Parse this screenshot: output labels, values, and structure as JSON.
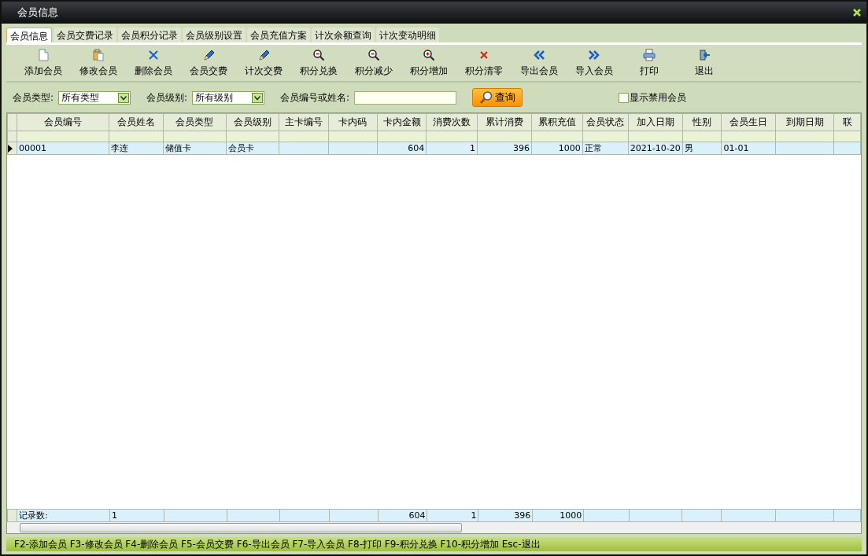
{
  "window": {
    "title": "会员信息"
  },
  "tabs": [
    {
      "label": "会员信息",
      "selected": true
    },
    {
      "label": "会员交费记录",
      "selected": false
    },
    {
      "label": "会员积分记录",
      "selected": false
    },
    {
      "label": "会员级别设置",
      "selected": false
    },
    {
      "label": "会员充值方案",
      "selected": false
    },
    {
      "label": "计次余额查询",
      "selected": false
    },
    {
      "label": "计次变动明细",
      "selected": false
    }
  ],
  "toolbar": [
    "添加会员",
    "修改会员",
    "删除会员",
    "会员交费",
    "计次交费",
    "积分兑换",
    "积分减少",
    "积分增加",
    "积分清零",
    "导出会员",
    "导入会员",
    "打印",
    "退出"
  ],
  "filters": {
    "type_label": "会员类型:",
    "type_value": "所有类型",
    "level_label": "会员级别:",
    "level_value": "所有级别",
    "search_label": "会员编号或姓名:",
    "search_button": "查询",
    "show_disabled": {
      "label": "显示禁用会员",
      "checked": false
    }
  },
  "table": {
    "columns": [
      {
        "label": "会员编号",
        "kind": "text"
      },
      {
        "label": "会员姓名",
        "kind": "text",
        "total": "1"
      },
      {
        "label": "会员类型",
        "kind": "text"
      },
      {
        "label": "会员级别",
        "kind": "text"
      },
      {
        "label": "主卡编号",
        "kind": "text"
      },
      {
        "label": "卡内码",
        "kind": "text"
      },
      {
        "label": "卡内金额",
        "kind": "number",
        "total": "604"
      },
      {
        "label": "消费次数",
        "kind": "number",
        "total": "1"
      },
      {
        "label": "累计消费",
        "kind": "number",
        "total": "396"
      },
      {
        "label": "累积充值",
        "kind": "number",
        "total": "1000"
      },
      {
        "label": "会员状态",
        "kind": "text"
      },
      {
        "label": "加入日期",
        "kind": "text"
      },
      {
        "label": "性别",
        "kind": "text"
      },
      {
        "label": "会员生日",
        "kind": "text"
      },
      {
        "label": "到期日期",
        "kind": "text"
      },
      {
        "label": "联",
        "kind": "text"
      }
    ],
    "rows": [
      {
        "selected": true,
        "cells": [
          "00001",
          "李连",
          "储值卡",
          "会员卡",
          null,
          null,
          "604",
          "1",
          "396",
          "1000",
          "正常",
          "2021-10-20",
          "男",
          "01-01",
          null,
          null
        ]
      }
    ],
    "footer_label": "记录数:"
  },
  "status_bar": "F2-添加会员 F3-修改会员 F4-删除会员 F5-会员交费 F6-导出会员 F7-导入会员 F8-打印 F9-积分兑换 F10-积分增加 Esc-退出"
}
